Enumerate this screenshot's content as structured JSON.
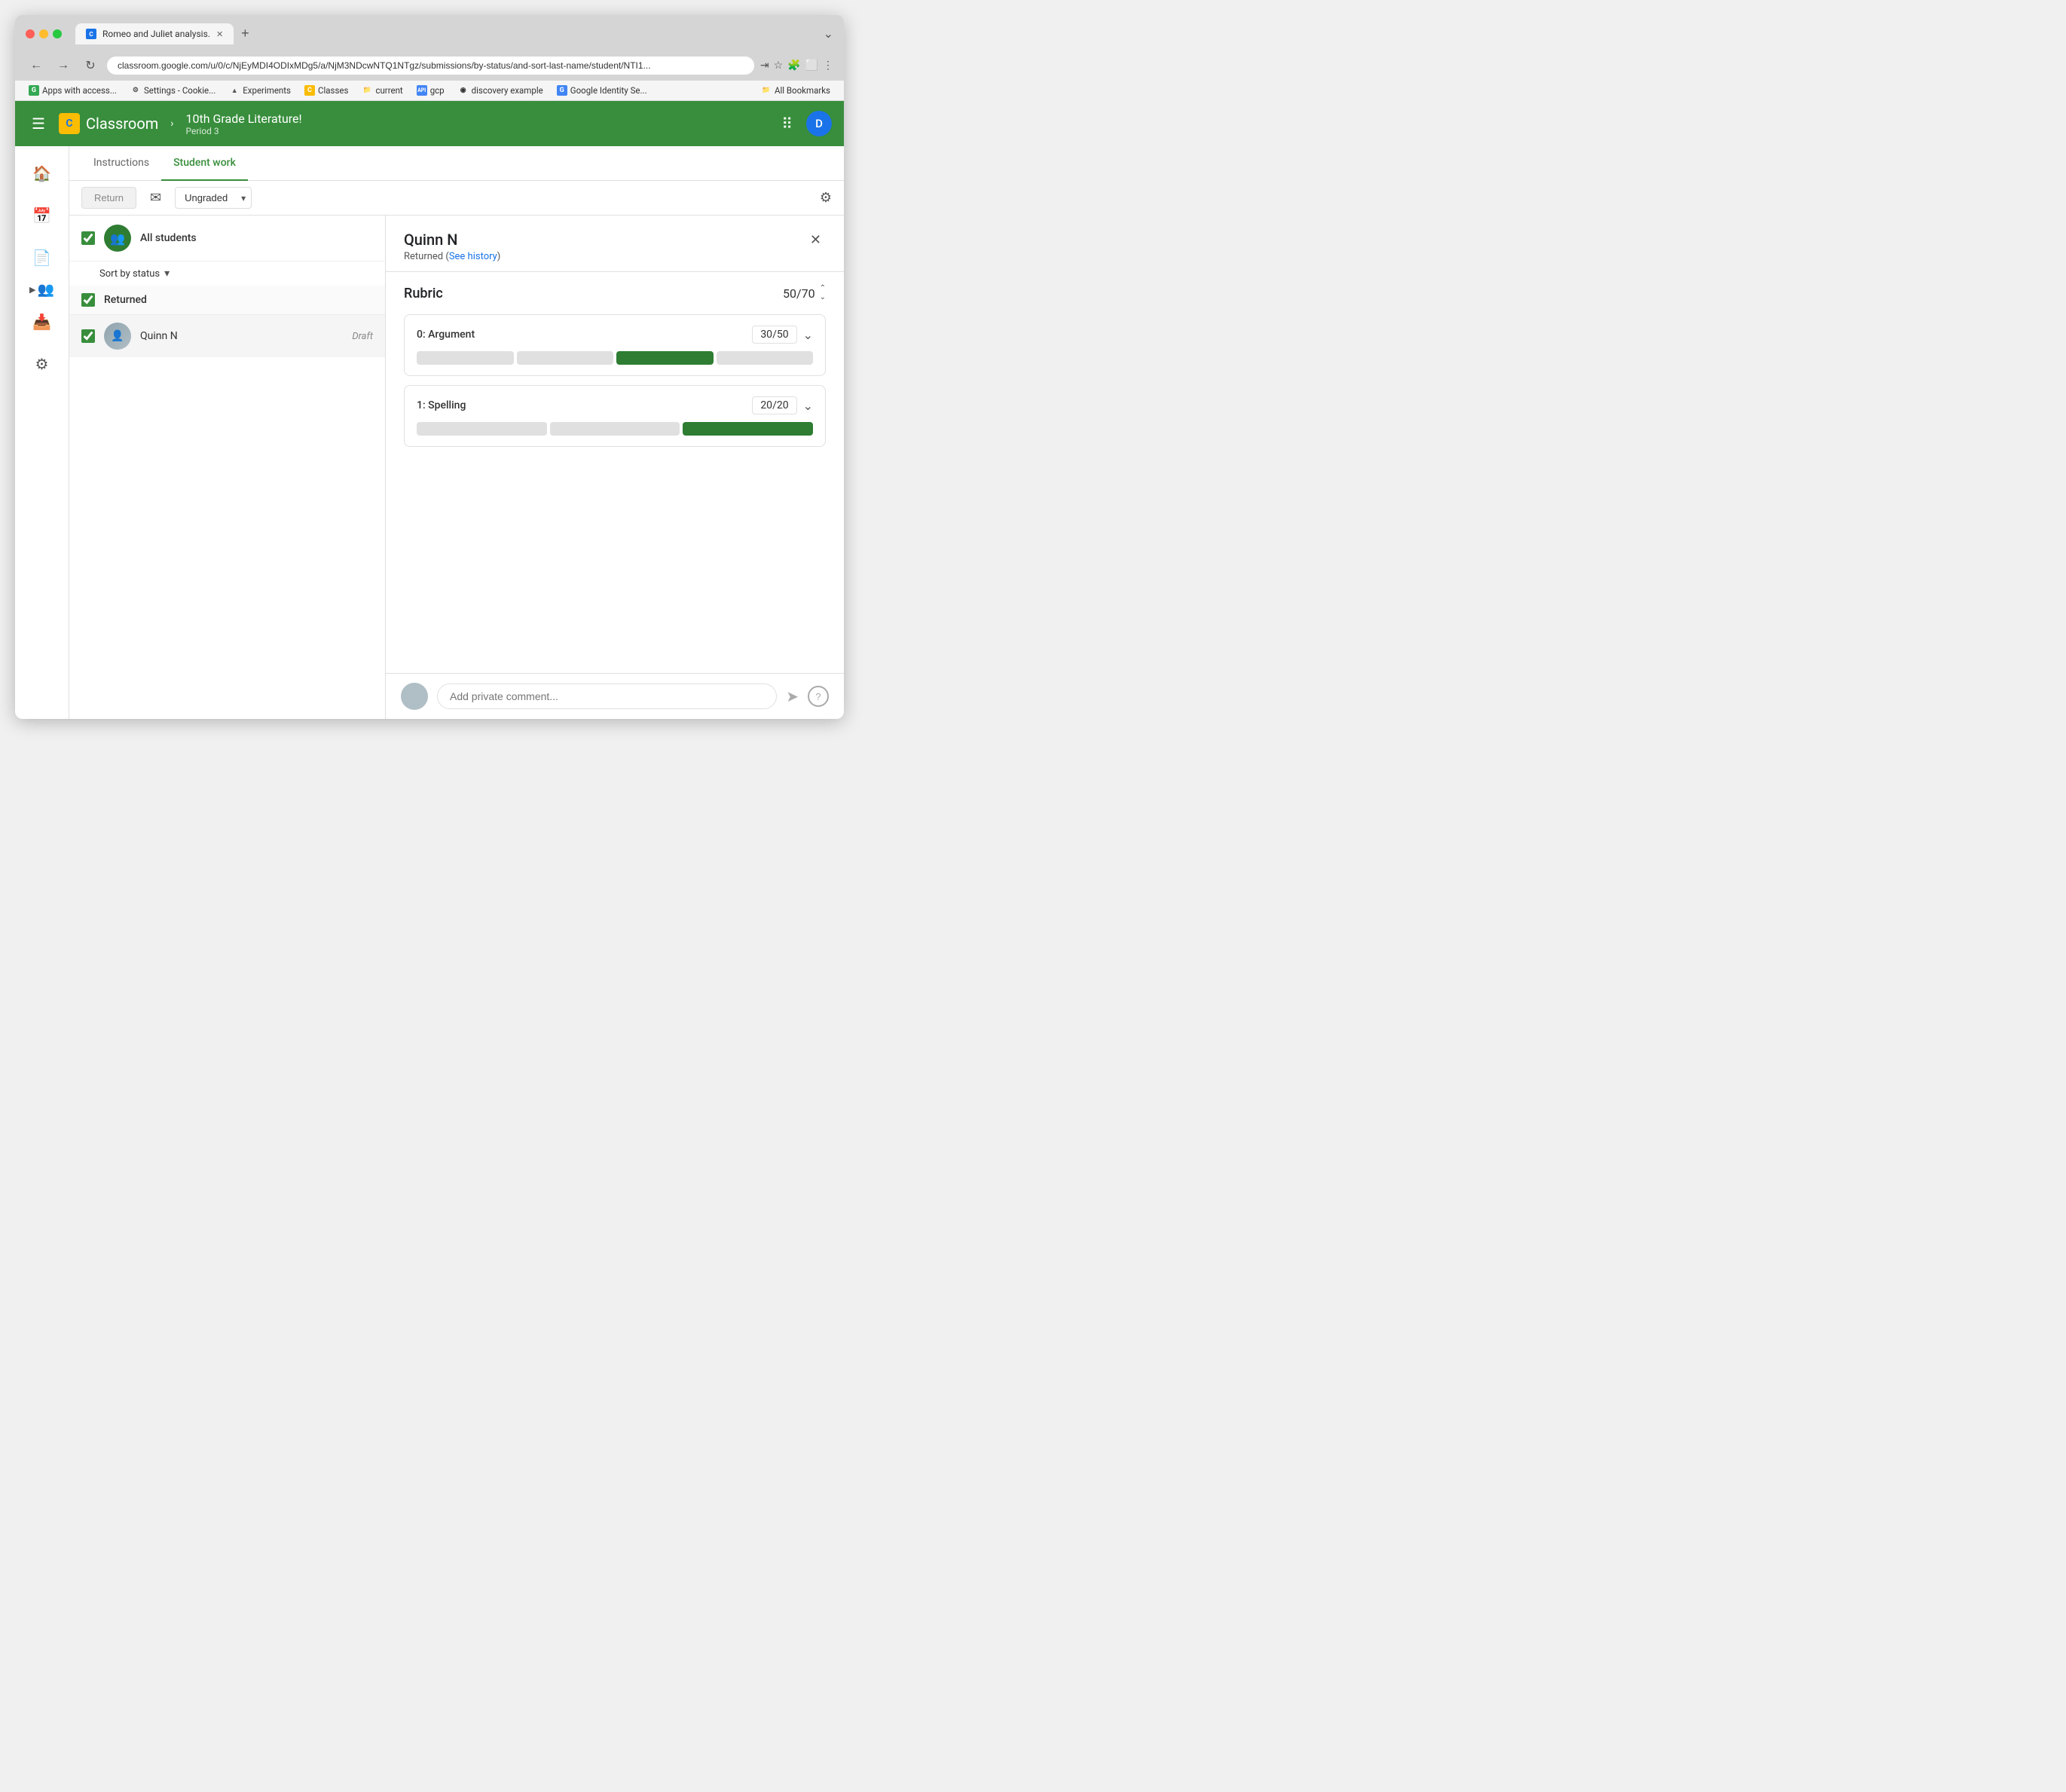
{
  "browser": {
    "tab_title": "Romeo and Juliet analysis.",
    "tab_favicon_label": "C",
    "url": "classroom.google.com/u/0/c/NjEyMDI4ODIxMDg5/a/NjM3NDcwNTQ1NTgz/submissions/by-status/and-sort-last-name/student/NTI1...",
    "new_tab_symbol": "+",
    "more_icon": "⌄",
    "bookmarks": [
      {
        "id": "apps",
        "icon_color": "#34a853",
        "icon_label": "G",
        "label": "Apps with access..."
      },
      {
        "id": "settings",
        "icon_color": "#4285f4",
        "icon_label": "⚙",
        "label": "Settings - Cookie..."
      },
      {
        "id": "experiments",
        "icon_color": "#fbbc04",
        "icon_label": "▲",
        "label": "Experiments"
      },
      {
        "id": "classes",
        "icon_color": "#ea4335",
        "icon_label": "C",
        "label": "Classes"
      },
      {
        "id": "current",
        "icon_color": "#555",
        "icon_label": "📁",
        "label": "current"
      },
      {
        "id": "api",
        "icon_color": "#1a73e8",
        "icon_label": "API",
        "label": "gcp"
      },
      {
        "id": "discovery",
        "icon_color": "#34a853",
        "icon_label": "◉",
        "label": "discovery example"
      },
      {
        "id": "google-identity",
        "icon_color": "#4285f4",
        "icon_label": "G",
        "label": "Google Identity Se..."
      },
      {
        "id": "all-bookmarks",
        "icon_color": "#555",
        "icon_label": "📁",
        "label": "All Bookmarks"
      }
    ]
  },
  "app": {
    "header": {
      "logo_icon_label": "C",
      "app_name": "Classroom",
      "breadcrumb_separator": "›",
      "course_title": "10th Grade Literature!",
      "course_period": "Period 3",
      "avatar_label": "D"
    },
    "sidebar": {
      "icons": [
        "🏠",
        "📅",
        "📄",
        "👥",
        "📥",
        "⚙"
      ]
    },
    "tabs": [
      {
        "id": "instructions",
        "label": "Instructions",
        "active": false
      },
      {
        "id": "student-work",
        "label": "Student work",
        "active": true
      }
    ],
    "toolbar": {
      "return_label": "Return",
      "email_icon": "✉",
      "filter_label": "Ungraded",
      "filter_arrow": "▾",
      "gear_icon": "⚙"
    },
    "student_list": {
      "all_students_label": "All students",
      "sort_label": "Sort by status",
      "sort_arrow": "▾",
      "sections": [
        {
          "id": "returned",
          "label": "Returned",
          "students": [
            {
              "id": "quinn-n",
              "name": "Quinn N",
              "status": "Draft"
            }
          ]
        }
      ]
    },
    "submission": {
      "student_name": "Quinn N",
      "status_text": "Returned (See history)",
      "see_history_label": "See history",
      "close_icon": "✕",
      "rubric_title": "Rubric",
      "rubric_total_score": "50",
      "rubric_total_max": "70",
      "rubric_up_icon": "⌃",
      "rubric_down_icon": "⌄",
      "rubric_items": [
        {
          "id": "argument",
          "name": "0: Argument",
          "score": "30",
          "max": "50",
          "segments": [
            {
              "selected": false
            },
            {
              "selected": false
            },
            {
              "selected": true
            },
            {
              "selected": false
            }
          ]
        },
        {
          "id": "spelling",
          "name": "1: Spelling",
          "score": "20",
          "max": "20",
          "segments": [
            {
              "selected": false
            },
            {
              "selected": false
            },
            {
              "selected": true
            }
          ]
        }
      ],
      "comment_placeholder": "Add private comment...",
      "send_icon": "➤",
      "help_icon": "?"
    }
  }
}
